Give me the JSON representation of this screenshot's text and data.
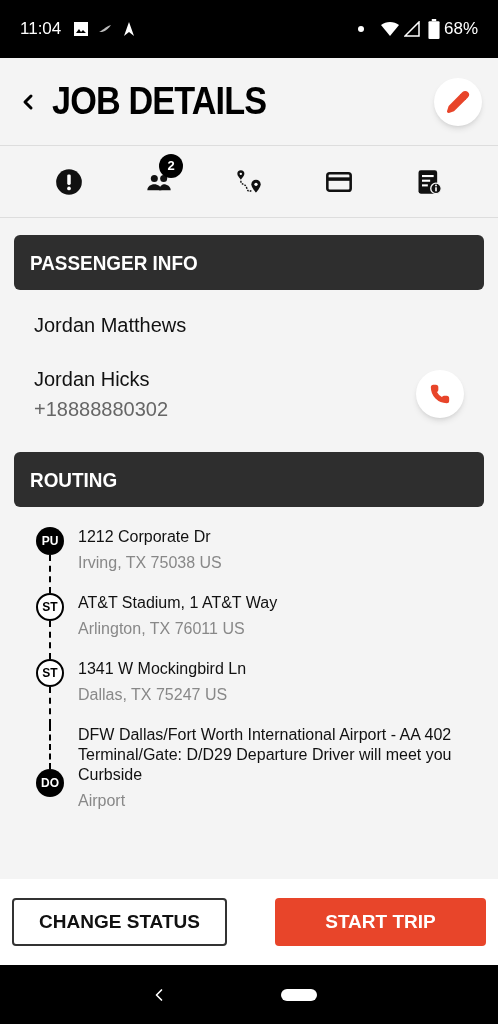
{
  "status_bar": {
    "time": "11:04",
    "battery": "68%"
  },
  "header": {
    "title": "JOB DETAILS"
  },
  "tabs": [
    {
      "kind": "alert"
    },
    {
      "kind": "passengers",
      "badge": "2"
    },
    {
      "kind": "route"
    },
    {
      "kind": "payment"
    },
    {
      "kind": "info"
    }
  ],
  "passenger_section": {
    "title": "PASSENGER INFO",
    "passengers": [
      {
        "name": "Jordan Matthews"
      },
      {
        "name": "Jordan Hicks",
        "phone": "+18888880302"
      }
    ]
  },
  "routing_section": {
    "title": "ROUTING",
    "stops": [
      {
        "kind": "pickup",
        "label": "PU",
        "lines": [
          "1212 Corporate Dr"
        ],
        "detail": "Irving, TX 75038 US"
      },
      {
        "kind": "stop",
        "label": "ST",
        "lines": [
          "AT&T Stadium, 1 AT&T Way"
        ],
        "detail": "Arlington, TX 76011 US"
      },
      {
        "kind": "stop",
        "label": "ST",
        "lines": [
          "1341 W Mockingbird Ln"
        ],
        "detail": "Dallas, TX 75247 US"
      },
      {
        "kind": "dropoff",
        "label": "DO",
        "lines": [
          "DFW Dallas/Fort Worth International Airport - AA 402",
          "Terminal/Gate: D/D29 Departure Driver will meet you",
          "Curbside"
        ],
        "detail": "Airport"
      }
    ]
  },
  "buttons": [
    {
      "kind": "secondary",
      "label": "CHANGE STATUS"
    },
    {
      "kind": "primary",
      "label": "START TRIP"
    }
  ]
}
